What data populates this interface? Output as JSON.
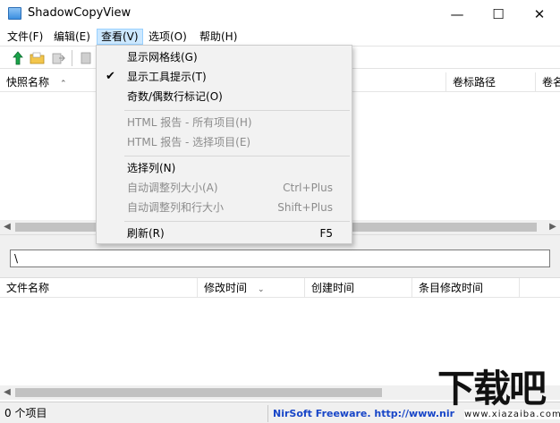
{
  "window": {
    "title": "ShadowCopyView",
    "minimize_glyph": "—",
    "maximize_glyph": "☐",
    "close_glyph": "✕"
  },
  "menubar": {
    "items": [
      {
        "label": "文件(F)"
      },
      {
        "label": "编辑(E)"
      },
      {
        "label": "查看(V)"
      },
      {
        "label": "选项(O)"
      },
      {
        "label": "帮助(H)"
      }
    ]
  },
  "toolbar": {
    "icons": [
      "up-arrow-icon",
      "folder-open-icon",
      "copy-files-icon",
      "properties-icon"
    ]
  },
  "snapshot_list": {
    "columns": [
      {
        "label": "快照名称"
      },
      {
        "label": "卷标路径"
      },
      {
        "label": "卷名"
      }
    ]
  },
  "path_field": {
    "value": "\\"
  },
  "file_list": {
    "columns": [
      {
        "label": "文件名称"
      },
      {
        "label": "修改时间"
      },
      {
        "label": "创建时间"
      },
      {
        "label": "条目修改时间"
      }
    ]
  },
  "statusbar": {
    "count": "0 个项目",
    "credit": "NirSoft Freeware.  http://www.nir"
  },
  "view_menu": {
    "items": [
      {
        "label": "显示网格线(G)",
        "shortcut": "",
        "checked": false,
        "enabled": true
      },
      {
        "label": "显示工具提示(T)",
        "shortcut": "",
        "checked": true,
        "enabled": true
      },
      {
        "label": "奇数/偶数行标记(O)",
        "shortcut": "",
        "checked": false,
        "enabled": true
      },
      {
        "label": "HTML 报告 - 所有项目(H)",
        "shortcut": "",
        "checked": false,
        "enabled": false
      },
      {
        "label": "HTML 报告 - 选择项目(E)",
        "shortcut": "",
        "checked": false,
        "enabled": false
      },
      {
        "label": "选择列(N)",
        "shortcut": "",
        "checked": false,
        "enabled": true
      },
      {
        "label": "自动调整列大小(A)",
        "shortcut": "Ctrl+Plus",
        "checked": false,
        "enabled": false
      },
      {
        "label": "自动调整列和行大小",
        "shortcut": "Shift+Plus",
        "checked": false,
        "enabled": false
      },
      {
        "label": "刷新(R)",
        "shortcut": "F5",
        "checked": false,
        "enabled": true
      }
    ],
    "check_glyph": "✔"
  },
  "watermark": {
    "text": "下载吧",
    "sub": "www.xiazaiba.com"
  },
  "colors": {
    "accent": "#cce8ff",
    "credit_link": "#1846c8"
  }
}
